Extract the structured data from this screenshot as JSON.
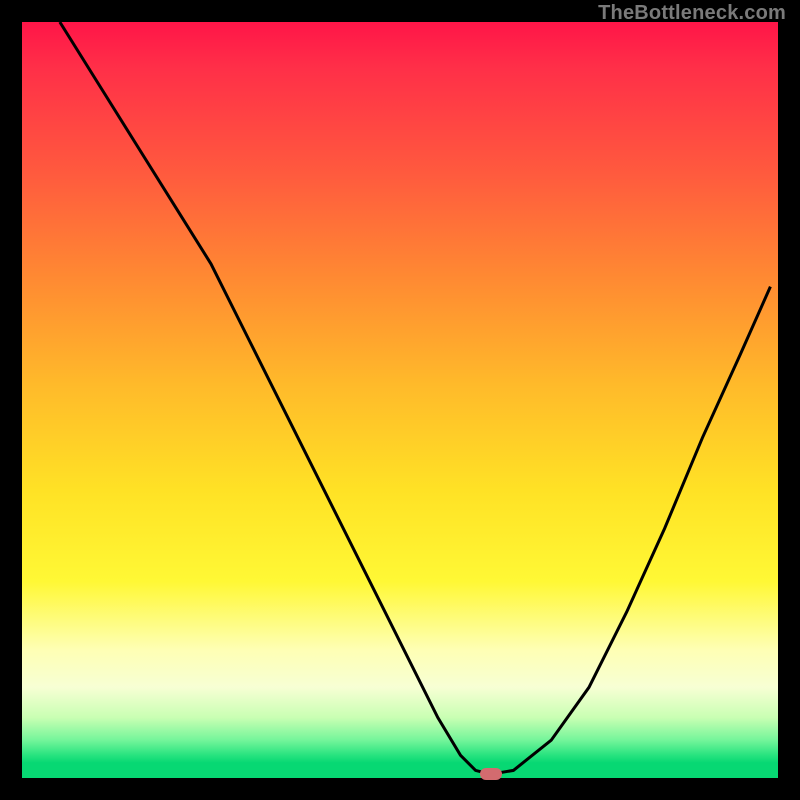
{
  "watermark": "TheBottleneck.com",
  "colors": {
    "frame": "#000000",
    "curve": "#000000",
    "marker": "#d36b6f",
    "gradient_top": "#ff1548",
    "gradient_bottom": "#07d873"
  },
  "chart_data": {
    "type": "line",
    "title": "",
    "xlabel": "",
    "ylabel": "",
    "xlim": [
      0,
      100
    ],
    "ylim": [
      0,
      100
    ],
    "grid": false,
    "legend": false,
    "series": [
      {
        "name": "bottleneck-curve",
        "x": [
          5,
          10,
          15,
          20,
          25,
          30,
          35,
          40,
          45,
          50,
          55,
          58,
          60,
          62,
          65,
          70,
          75,
          80,
          85,
          90,
          95,
          99
        ],
        "y": [
          100,
          92,
          84,
          76,
          68,
          58,
          48,
          38,
          28,
          18,
          8,
          3,
          1,
          0.5,
          1,
          5,
          12,
          22,
          33,
          45,
          56,
          65
        ]
      }
    ],
    "annotations": [
      {
        "name": "optimal-marker",
        "x": 62,
        "y": 0.5
      }
    ],
    "background_gradient": {
      "orientation": "vertical",
      "stops": [
        {
          "pos": 0.0,
          "color": "#ff1548"
        },
        {
          "pos": 0.2,
          "color": "#ff5a3e"
        },
        {
          "pos": 0.48,
          "color": "#ffba2a"
        },
        {
          "pos": 0.74,
          "color": "#fff835"
        },
        {
          "pos": 0.88,
          "color": "#f7ffd4"
        },
        {
          "pos": 0.97,
          "color": "#27e37f"
        },
        {
          "pos": 1.0,
          "color": "#07d873"
        }
      ]
    }
  }
}
